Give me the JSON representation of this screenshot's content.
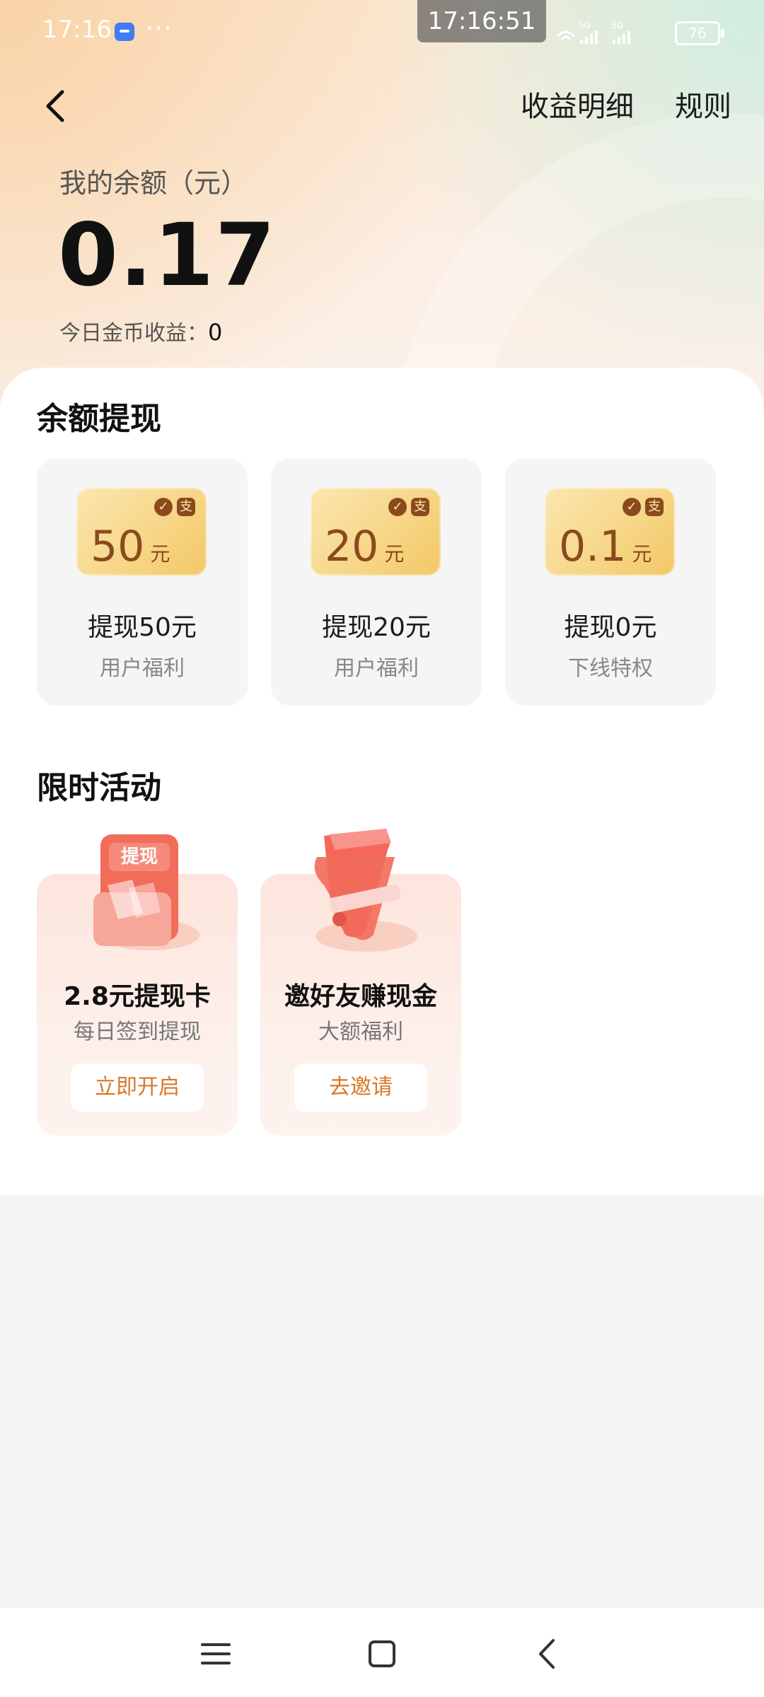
{
  "status_bar": {
    "time": "17:16",
    "more": "···",
    "overlay_time": "17:16:51",
    "signal_text": "5G 5G",
    "battery": "76"
  },
  "header": {
    "income_details": "收益明细",
    "rules": "规则"
  },
  "balance": {
    "label": "我的余额（元）",
    "value": "0.17",
    "coin_label": "今日金币收益：",
    "coin_value": "0"
  },
  "withdraw": {
    "title": "余额提现",
    "items": [
      {
        "amount": "50",
        "unit": "元",
        "title": "提现50元",
        "subtitle": "用户福利"
      },
      {
        "amount": "20",
        "unit": "元",
        "title": "提现20元",
        "subtitle": "用户福利"
      },
      {
        "amount": "0.1",
        "unit": "元",
        "title": "提现0元",
        "subtitle": "下线特权"
      }
    ],
    "wechat_glyph": "✓",
    "alipay_glyph": "支"
  },
  "activities": {
    "title": "限时活动",
    "items": [
      {
        "badge": "提现",
        "title": "2.8元提现卡",
        "subtitle": "每日签到提现",
        "button": "立即开启"
      },
      {
        "title": "邀好友赚现金",
        "subtitle": "大额福利",
        "button": "去邀请"
      }
    ]
  },
  "colors": {
    "accent_orange": "#d8782a",
    "ticket_text": "#8a4a1d"
  }
}
